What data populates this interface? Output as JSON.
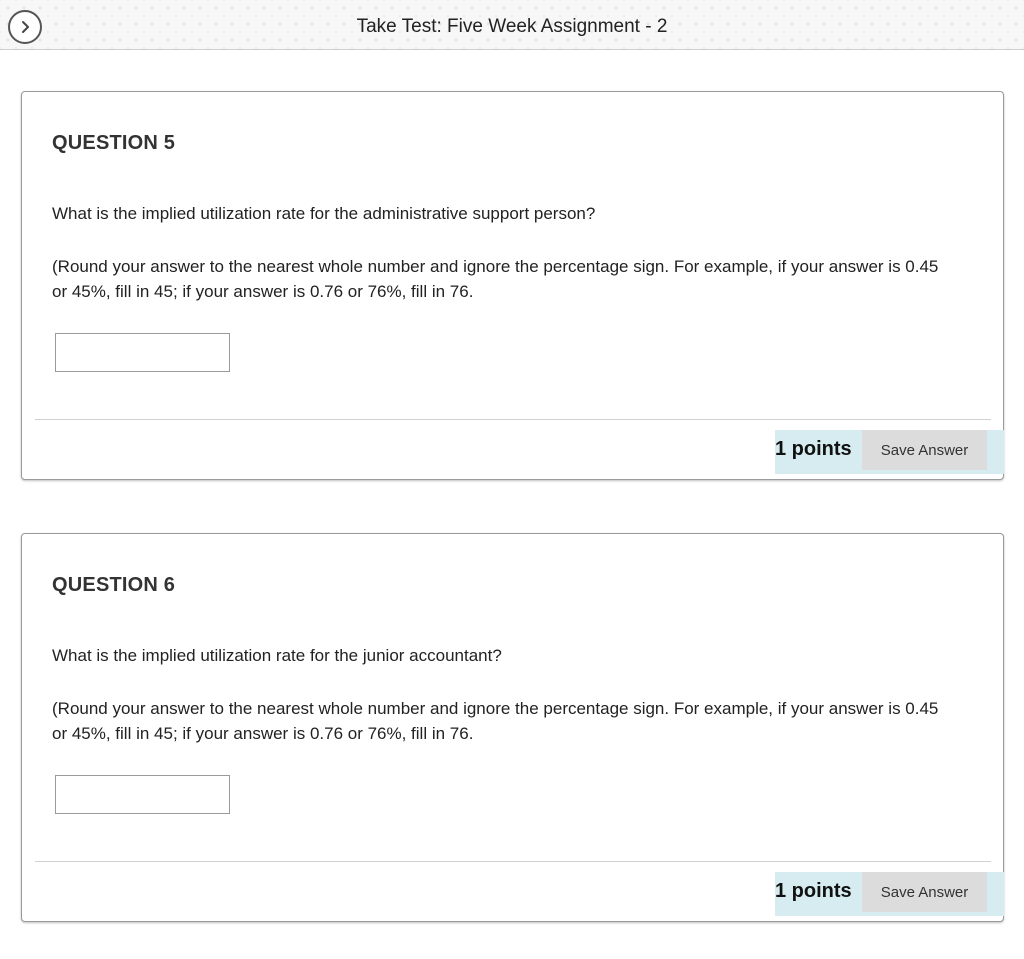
{
  "header": {
    "title": "Take Test: Five Week Assignment - 2",
    "nav_icon": "chevron-right-icon"
  },
  "questions": [
    {
      "heading": "QUESTION 5",
      "text": "What is the implied utilization rate for the administrative support person?",
      "instruction": "(Round your answer to the nearest whole number and ignore the percentage sign. For example, if your answer is 0.45 or 45%, fill in 45; if your answer is 0.76 or 76%, fill in 76.",
      "answer_value": "",
      "points": "1 points",
      "save_label": "Save Answer"
    },
    {
      "heading": "QUESTION 6",
      "text": "What is the implied utilization rate for the junior accountant?",
      "instruction": "(Round your answer to the nearest whole number and ignore the percentage sign. For example, if your answer is 0.45 or 45%, fill in 45; if your answer is 0.76 or 76%, fill in 76.",
      "answer_value": "",
      "points": "1 points",
      "save_label": "Save Answer"
    }
  ],
  "colors": {
    "footer_bg": "#d6ecf1",
    "button_bg": "#dcdcdc",
    "card_border": "#9a9a9a"
  }
}
